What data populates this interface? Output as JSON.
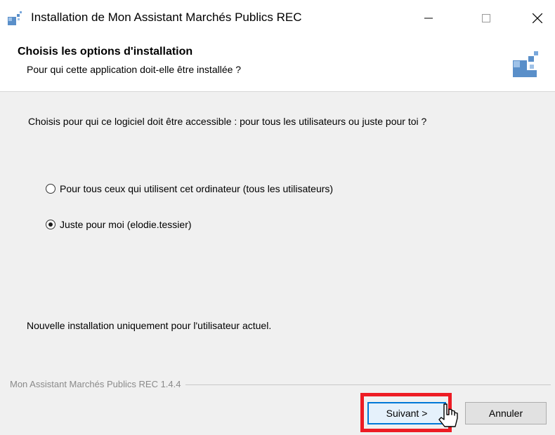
{
  "window": {
    "title": "Installation de Mon Assistant Marchés Publics REC",
    "icon": "installer-icon",
    "controls": [
      "minimize-icon",
      "maximize-icon",
      "close-icon"
    ]
  },
  "header": {
    "title": "Choisis les options d'installation",
    "subtitle": "Pour qui cette application doit-elle être installée ?"
  },
  "main": {
    "question": "Choisis pour qui ce logiciel doit être accessible : pour tous les utilisateurs ou juste pour toi ?",
    "options": [
      {
        "label": "Pour tous ceux qui utilisent cet ordinateur (tous les utilisateurs)",
        "selected": false
      },
      {
        "label": "Juste pour moi (elodie.tessier)",
        "selected": true
      }
    ],
    "description": "Nouvelle installation uniquement pour l'utilisateur actuel."
  },
  "footer": {
    "product": "Mon Assistant Marchés Publics REC 1.4.4",
    "next_label": "Suivant >",
    "cancel_label": "Annuler"
  },
  "colors": {
    "highlight": "#ed1c24",
    "focus_border": "#0078d7",
    "logo_blue": "#5a8fc9"
  }
}
